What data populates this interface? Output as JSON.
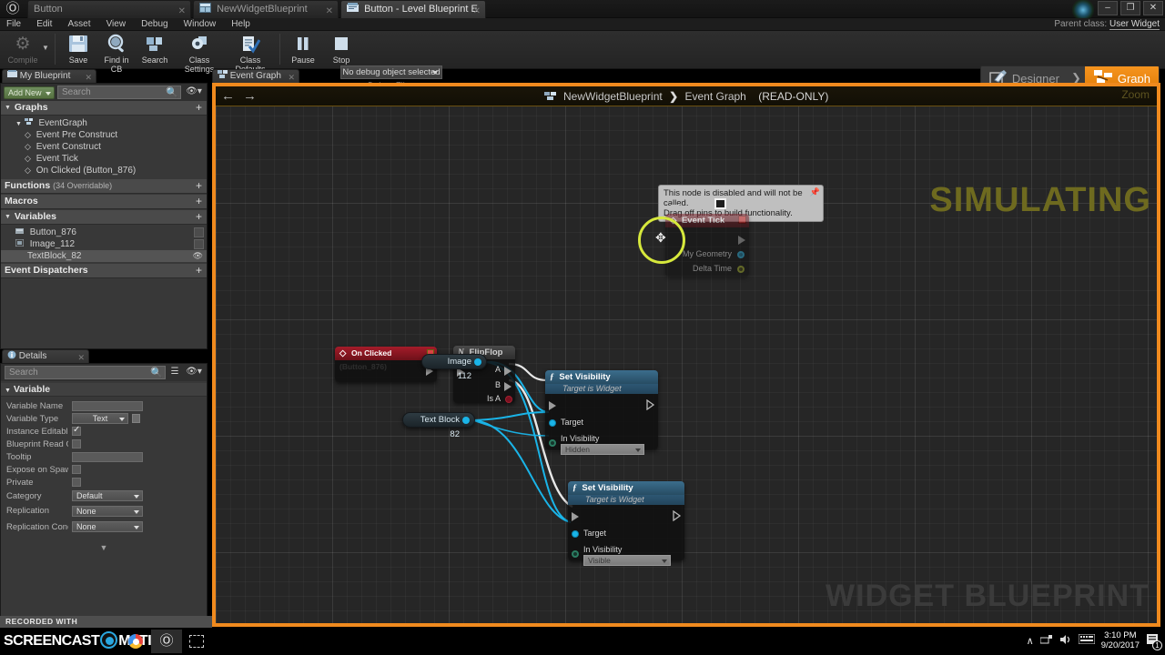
{
  "window": {
    "tabs": [
      {
        "label": "Button",
        "icon": "none",
        "active": false
      },
      {
        "label": "NewWidgetBlueprint",
        "icon": "widget-blueprint-icon",
        "active": false
      },
      {
        "label": "Button - Level Blueprint E",
        "icon": "level-blueprint-icon",
        "active": true
      }
    ],
    "buttons": {
      "minimize": "–",
      "maximize": "❐",
      "close": "✕"
    },
    "parent_class_label": "Parent class:",
    "parent_class_value": "User Widget"
  },
  "menu": [
    "File",
    "Edit",
    "Asset",
    "View",
    "Debug",
    "Window",
    "Help"
  ],
  "toolbar": {
    "items": [
      {
        "label": "Compile",
        "icon": "compile-gears-icon",
        "dim": true
      },
      {
        "label": "Save",
        "icon": "floppy-save-icon",
        "dim": false
      },
      {
        "label": "Find in CB",
        "icon": "magnifier-icon",
        "dim": false
      },
      {
        "label": "Search",
        "icon": "search-nodes-icon",
        "dim": false
      },
      {
        "label": "Class Settings",
        "icon": "gear-grid-icon",
        "dim": false
      },
      {
        "label": "Class Defaults",
        "icon": "clipboard-check-icon",
        "dim": false
      },
      {
        "label": "Pause",
        "icon": "pause-icon",
        "dim": false
      },
      {
        "label": "Stop",
        "icon": "stop-square-icon",
        "dim": false
      }
    ],
    "debug_filter": {
      "value": "No debug object selected",
      "label": "Debug Filter"
    },
    "mode_switch": {
      "designer": "Designer",
      "graph": "Graph",
      "separator": "❯",
      "active": "Graph"
    }
  },
  "panels": {
    "my_blueprint": {
      "tab_label": "My Blueprint",
      "add_button": "Add New",
      "search_placeholder": "Search",
      "sections": [
        {
          "title": "Graphs",
          "count": "",
          "plus": "+"
        },
        {
          "title": "Functions",
          "count": "(34 Overridable)",
          "plus": "+"
        },
        {
          "title": "Macros",
          "count": "",
          "plus": "+"
        },
        {
          "title": "Variables",
          "count": "",
          "plus": "+"
        },
        {
          "title": "Event Dispatchers",
          "count": "",
          "plus": "+"
        }
      ],
      "graph_tree": {
        "root": "EventGraph",
        "nodes": [
          "Event Pre Construct",
          "Event Construct",
          "Event Tick",
          "On Clicked (Button_876)"
        ]
      },
      "variables": [
        {
          "name": "Button_876",
          "selected": false
        },
        {
          "name": "Image_112",
          "selected": false
        },
        {
          "name": "TextBlock_82",
          "selected": true
        }
      ]
    },
    "details": {
      "tab_label": "Details",
      "search_placeholder": "Search",
      "section_title": "Variable",
      "rows": [
        {
          "label": "Variable Name",
          "kind": "text",
          "value": ""
        },
        {
          "label": "Variable Type",
          "kind": "combo",
          "value": "Text"
        },
        {
          "label": "Instance Editable",
          "kind": "check",
          "value": "checked"
        },
        {
          "label": "Blueprint Read Onl",
          "kind": "check",
          "value": ""
        },
        {
          "label": "Tooltip",
          "kind": "text",
          "value": ""
        },
        {
          "label": "Expose on Spawn",
          "kind": "check",
          "value": ""
        },
        {
          "label": "Private",
          "kind": "check",
          "value": ""
        },
        {
          "label": "Category",
          "kind": "combo",
          "value": "Default"
        },
        {
          "label": "Replication",
          "kind": "combo",
          "value": "None"
        },
        {
          "label": "Replication Conditi",
          "kind": "combo",
          "value": "None"
        }
      ]
    }
  },
  "graph": {
    "tab_label": "Event Graph",
    "back_arrow": "←",
    "forward_arrow": "→",
    "breadcrumb": {
      "asset": "NewWidgetBlueprint",
      "separator": "❯",
      "graph": "Event Graph",
      "readonly": "(READ-ONLY)"
    },
    "zoom_label": "Zoom",
    "watermark_simulating": "SIMULATING",
    "watermark_widget": "WIDGET BLUEPRINT",
    "tooltip": {
      "line1": "This node is disabled and will not be called.",
      "line2": "Drag off pins to build functionality."
    },
    "nodes": [
      {
        "id": "event-tick",
        "title": "Event Tick",
        "header_color": "#6a1620",
        "pins_out": [
          "My Geometry",
          "Delta Time"
        ],
        "disabled": true
      },
      {
        "id": "on-clicked",
        "title": "On Clicked (Button_876)",
        "header_color": "#9f1623"
      },
      {
        "id": "flipflop",
        "title": "FlipFlop",
        "header_color": "#3c3c3c",
        "pins_out": [
          "A",
          "B",
          "Is A"
        ]
      },
      {
        "id": "set-visibility-1",
        "title": "Set Visibility",
        "subtitle": "Target is Widget",
        "header_color": "#2e5d78",
        "pins": [
          "Target",
          "In Visibility"
        ],
        "visibility": "Hidden"
      },
      {
        "id": "set-visibility-2",
        "title": "Set Visibility",
        "subtitle": "Target is Widget",
        "header_color": "#2e5d78",
        "pins": [
          "Target",
          "In Visibility"
        ],
        "visibility": "Visible"
      }
    ],
    "variable_nodes": [
      {
        "id": "image-112",
        "label": "Image 112"
      },
      {
        "id": "text-block-82",
        "label": "Text Block 82"
      }
    ],
    "colors": {
      "accent_border": "#f08a1e",
      "wire_data": "#1ab4e8",
      "wire_exec": "#cfcfcf",
      "grid": "#262626"
    }
  },
  "taskbar": {
    "recorded_with": "RECORDED WITH",
    "brand_left": "SCREENCAST",
    "brand_right": "MATIC",
    "items": [
      {
        "name": "chrome-icon"
      },
      {
        "name": "unreal-engine-icon"
      },
      {
        "name": "snip-tool-icon"
      }
    ],
    "tray": {
      "chevron": "∧",
      "network": "⚇",
      "volume": "ὐA",
      "keyboard": "⌨",
      "time": "3:10 PM",
      "date": "9/20/2017",
      "notifications": "1"
    }
  }
}
